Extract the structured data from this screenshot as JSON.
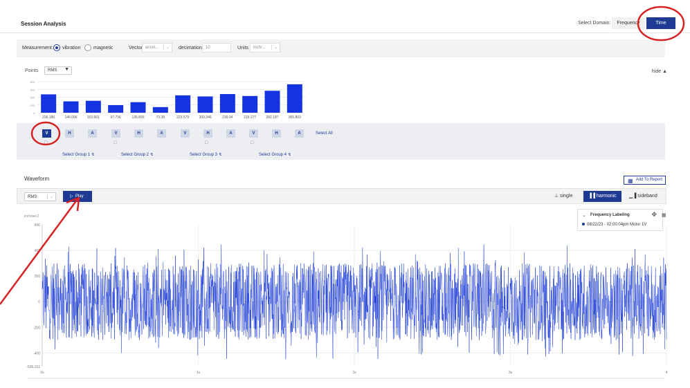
{
  "header": {
    "title": "Session Analysis",
    "domain_label": "Select Domain:",
    "frequency_label": "Frequency",
    "time_label": "Time"
  },
  "measurement": {
    "label": "Measurement:",
    "options": [
      "vibration",
      "magnetic"
    ],
    "selected": "vibration",
    "vector_label": "Vector",
    "vector_value": "accel...",
    "decimation_label": "decimation",
    "decimation_value": "10",
    "units_label": "Units",
    "units_value": "inch/..."
  },
  "points": {
    "label": "Points",
    "select_value": "RMS",
    "hide_label": "hide"
  },
  "groups": {
    "channels": [
      "V",
      "H",
      "A"
    ],
    "labels": [
      "Select Group 1",
      "Select Group 2",
      "Select Group 3",
      "Select Group 4"
    ],
    "select_all": "Select All",
    "active": "V"
  },
  "waveform": {
    "title": "Waveform",
    "add_to_report": "Add To Report",
    "select_value": "RMS",
    "play_label": "Play",
    "modes": [
      "single",
      "harmonic",
      "sideband"
    ],
    "active_mode": "harmonic"
  },
  "frequency_labeling": {
    "title": "Frequency Labeling",
    "item": "08/22/23 - 02:00:04pm Motor 1V"
  },
  "colors": {
    "accent": "#1f3a93",
    "bar": "#1533e0",
    "wave": "#1f3fd6",
    "annotation": "#d62222"
  },
  "chart_data": [
    {
      "type": "bar",
      "categories": [
        "236.186",
        "146.096",
        "153.661",
        "97.736",
        "135.893",
        "72.39",
        "223.579",
        "209.346",
        "239.94",
        "215.277",
        "282.187",
        "365.803"
      ],
      "values": [
        236.186,
        146.096,
        153.661,
        97.736,
        135.893,
        72.39,
        223.579,
        209.346,
        239.94,
        215.277,
        282.187,
        365.803
      ],
      "yticks": [
        "400",
        "300",
        "200",
        "100",
        "0"
      ],
      "ylim": [
        0,
        400
      ]
    },
    {
      "type": "line",
      "ylabel": "inch/sec2",
      "yticks": [
        "600",
        "400",
        "200",
        "0",
        "-200",
        "-400",
        "-506.151"
      ],
      "xticks": [
        "0s",
        "1s",
        "2s",
        "3s",
        "4"
      ],
      "ylim": [
        -506.151,
        600
      ],
      "xlim": [
        0,
        4
      ],
      "amplitude_typical": 300,
      "amplitude_peak": 450
    }
  ]
}
